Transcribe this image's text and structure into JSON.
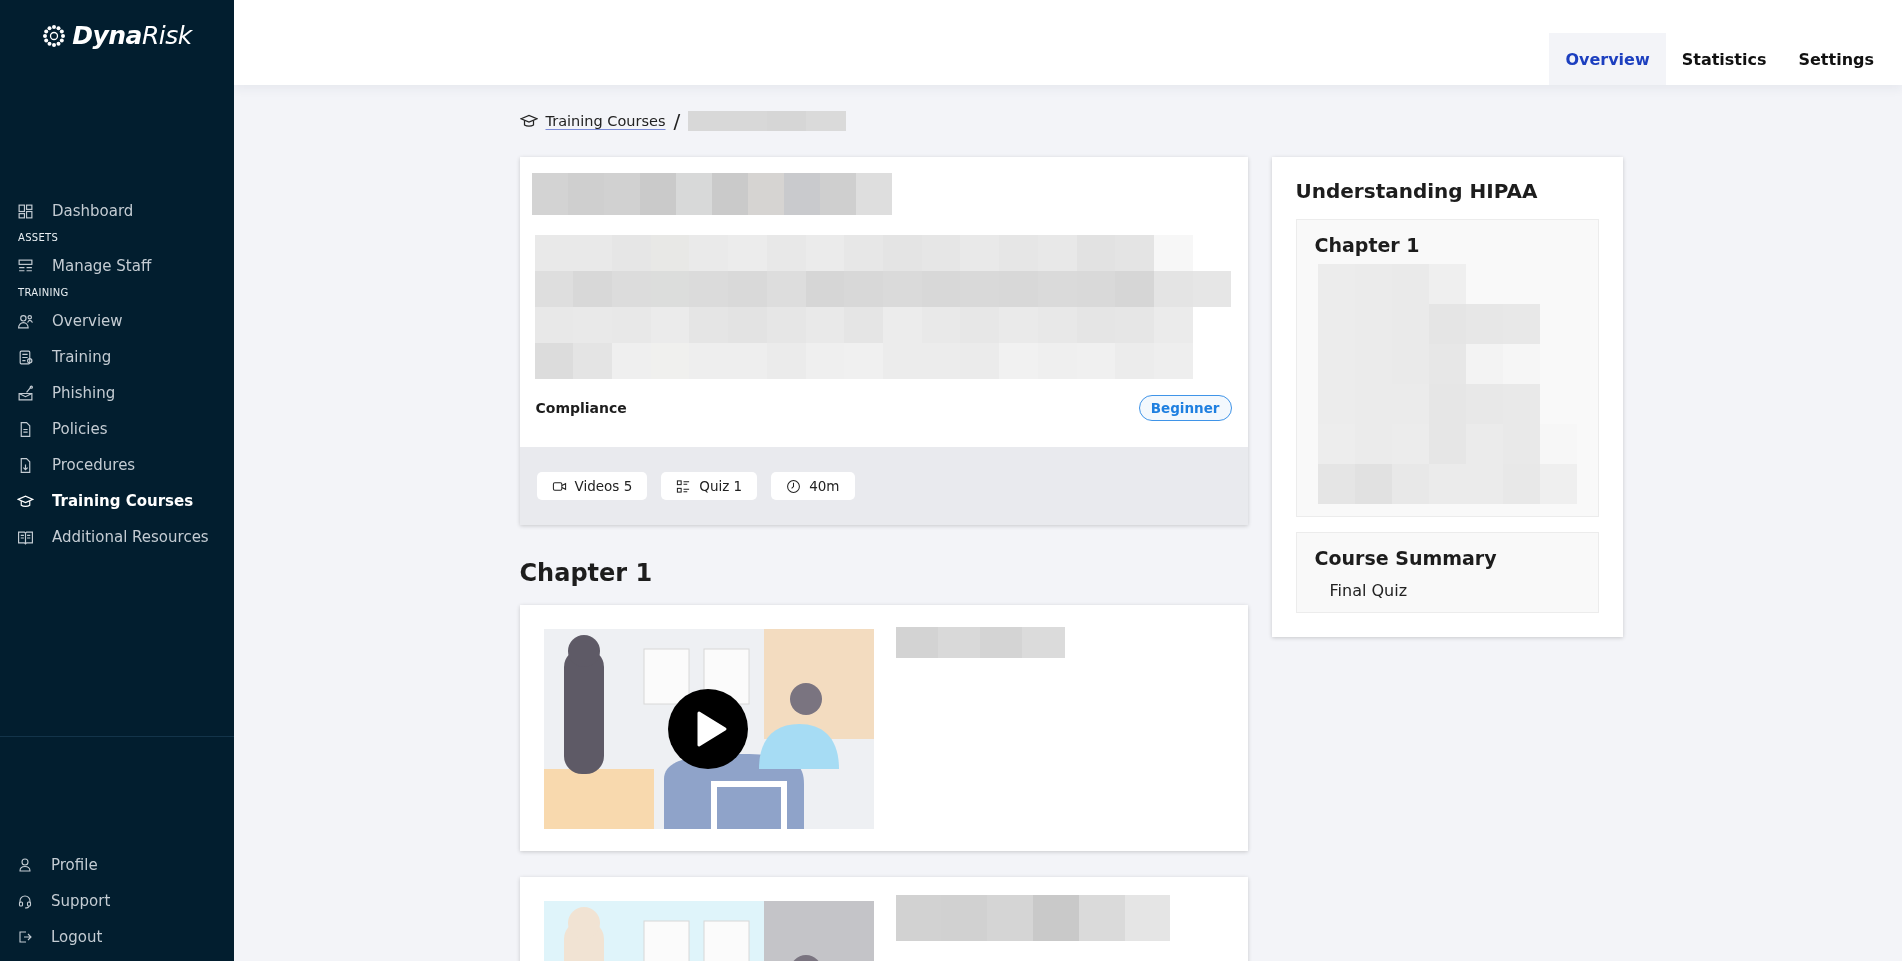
{
  "sidebar": {
    "logo": "**Dyna**Risk",
    "nav": [
      {
        "kind": "item",
        "label": "Dashboard",
        "selected": false
      },
      {
        "kind": "heading",
        "label": "ASSETS"
      },
      {
        "kind": "item",
        "label": "Manage Staff",
        "selected": false
      },
      {
        "kind": "heading",
        "label": "TRAINING"
      },
      {
        "kind": "item",
        "label": "Overview",
        "selected": false
      },
      {
        "kind": "item",
        "label": "Training",
        "selected": false
      },
      {
        "kind": "item",
        "label": "Phishing",
        "selected": false
      },
      {
        "kind": "item",
        "label": "Policies",
        "selected": false
      },
      {
        "kind": "item",
        "label": "Procedures",
        "selected": false
      },
      {
        "kind": "item",
        "label": "Training Courses",
        "selected": true
      },
      {
        "kind": "item",
        "label": "Additional Resources",
        "selected": false
      }
    ],
    "footer_items": [
      {
        "label": "Profile"
      },
      {
        "label": "Support"
      },
      {
        "label": "Logout"
      }
    ]
  },
  "tabs": [
    {
      "label": "Overview",
      "selected": true
    },
    {
      "label": "Statistics",
      "selected": false
    },
    {
      "label": "Settings",
      "selected": false
    }
  ],
  "breadcrumb": {
    "link": "Training Courses",
    "separator": "/"
  },
  "course": {
    "category": "Compliance",
    "level_badge": "Beginner",
    "stats": [
      {
        "label": "Videos 5"
      },
      {
        "label": "Quiz 1"
      },
      {
        "label": "40m"
      }
    ]
  },
  "chapter_heading": "Chapter 1",
  "outline": {
    "title": "Understanding HIPAA",
    "sections": [
      {
        "title": "Chapter 1"
      },
      {
        "title": "Course Summary",
        "items": [
          "Final Quiz"
        ]
      }
    ]
  }
}
